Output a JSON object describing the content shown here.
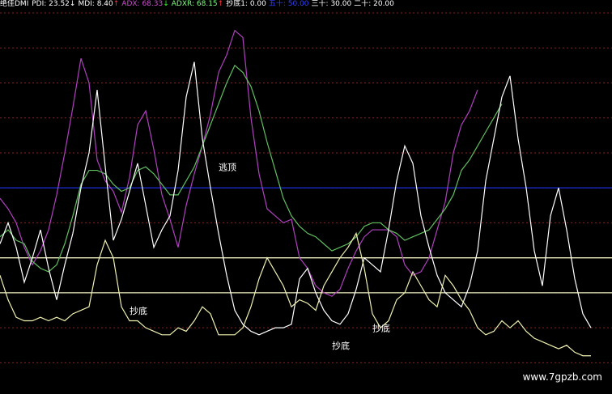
{
  "header": {
    "indicator_name": "绝佳DMI",
    "items": [
      {
        "text": "PDI: 23.52",
        "arrow": "↓",
        "color": "#ffffff",
        "arrow_color": "#ffffff"
      },
      {
        "text": "MDI: 8.40",
        "arrow": "↑",
        "color": "#ffffff",
        "arrow_color": "#ff3030"
      },
      {
        "text": "ADX: 68.33",
        "arrow": "↓",
        "color": "#d050d0",
        "arrow_color": "#30ff30"
      },
      {
        "text": "ADXR: 68.15",
        "arrow": "↑",
        "color": "#80ff80",
        "arrow_color": "#ff3030"
      },
      {
        "text": "抄底1: 0.00",
        "arrow": "",
        "color": "#ffffff",
        "arrow_color": "#ffffff"
      },
      {
        "text": "五十: 50.00",
        "arrow": "",
        "color": "#3040ff",
        "arrow_color": "#ffffff"
      },
      {
        "text": "三十: 30.00",
        "arrow": "",
        "color": "#ffffff",
        "arrow_color": "#ffffff"
      },
      {
        "text": "二十: 20.00",
        "arrow": "",
        "color": "#ffffff",
        "arrow_color": "#ffffff"
      }
    ]
  },
  "watermark": "www.7gpzb.com",
  "colors": {
    "background": "#000000",
    "pdi": "#ffffff",
    "mdi": "#f0f0b0",
    "adx": "#b040c0",
    "adxr": "#60c060",
    "fifty": "#1828c8",
    "thirty": "#f0f0c0",
    "twenty": "#f0f0c0",
    "grid": "#8a2020"
  },
  "chart_data": {
    "type": "line",
    "ylim": [
      -5,
      100
    ],
    "grid": true,
    "x": [
      0,
      1,
      2,
      3,
      4,
      5,
      6,
      7,
      8,
      9,
      10,
      11,
      12,
      13,
      14,
      15,
      16,
      17,
      18,
      19,
      20,
      21,
      22,
      23,
      24,
      25,
      26,
      27,
      28,
      29,
      30,
      31,
      32,
      33,
      34,
      35,
      36,
      37,
      38,
      39,
      40,
      41,
      42,
      43,
      44,
      45,
      46,
      47,
      48,
      49,
      50,
      51,
      52,
      53,
      54,
      55,
      56,
      57,
      58,
      59,
      60,
      61,
      62,
      63,
      64,
      65,
      66,
      67,
      68,
      69,
      70,
      71,
      72,
      73
    ],
    "series": [
      {
        "name": "ADX",
        "values": [
          47,
          44,
          40,
          33,
          28,
          32,
          38,
          48,
          60,
          73,
          87,
          80,
          58,
          52,
          49,
          43,
          53,
          68,
          72,
          61,
          48,
          41,
          33,
          45,
          54,
          62,
          71,
          83,
          88,
          95,
          93,
          70,
          54,
          44,
          42,
          40,
          41,
          30,
          27,
          22,
          20,
          19,
          21,
          27,
          32,
          36,
          38,
          38,
          38,
          36,
          28,
          25,
          26,
          30,
          38,
          46,
          60,
          68,
          72,
          78
        ]
      },
      {
        "name": "ADXR",
        "values": [
          36,
          38,
          35,
          34,
          29,
          27,
          26,
          28,
          34,
          42,
          51,
          55,
          55,
          54,
          51,
          49,
          50,
          55,
          56,
          54,
          51,
          48,
          48,
          52,
          56,
          62,
          68,
          74,
          80,
          85,
          83,
          79,
          72,
          63,
          55,
          47,
          42,
          39,
          37,
          36,
          34,
          32,
          33,
          34,
          36,
          39,
          40,
          40,
          38,
          37,
          35,
          36,
          37,
          38,
          41,
          44,
          48,
          55,
          58,
          62,
          66,
          70,
          74
        ]
      },
      {
        "name": "PDI",
        "values": [
          34,
          40,
          33,
          23,
          30,
          38,
          27,
          18,
          28,
          37,
          50,
          60,
          78,
          56,
          35,
          41,
          49,
          57,
          45,
          33,
          38,
          42,
          55,
          76,
          86,
          64,
          50,
          37,
          25,
          15,
          11,
          9,
          8,
          9,
          10,
          10,
          11,
          24,
          27,
          20,
          15,
          12,
          11,
          14,
          21,
          30,
          28,
          26,
          38,
          52,
          62,
          57,
          42,
          33,
          25,
          20,
          18,
          16,
          22,
          32,
          52,
          64,
          76,
          82,
          64,
          50,
          32,
          22,
          42,
          50,
          38,
          24,
          14,
          10
        ]
      },
      {
        "name": "MDI",
        "values": [
          25,
          18,
          13,
          12,
          12,
          13,
          12,
          13,
          12,
          14,
          15,
          16,
          28,
          35,
          30,
          16,
          12,
          12,
          10,
          9,
          8,
          8,
          10,
          9,
          12,
          16,
          14,
          8,
          8,
          8,
          10,
          16,
          24,
          30,
          26,
          22,
          16,
          18,
          17,
          15,
          22,
          26,
          30,
          33,
          37,
          27,
          14,
          10,
          12,
          18,
          20,
          26,
          22,
          18,
          16,
          25,
          22,
          18,
          15,
          10,
          8,
          9,
          12,
          10,
          12,
          9,
          7,
          6,
          5,
          4,
          5,
          3,
          2,
          2
        ]
      }
    ],
    "reference_lines": [
      {
        "name": "五十",
        "value": 50
      },
      {
        "name": "三十",
        "value": 30
      },
      {
        "name": "二十",
        "value": 20
      }
    ],
    "annotations": [
      {
        "text": "逃顶",
        "x": 27,
        "y": 55
      },
      {
        "text": "抄底",
        "x": 16,
        "y": 14
      },
      {
        "text": "抄底",
        "x": 41,
        "y": 4
      },
      {
        "text": "抄底",
        "x": 46,
        "y": 9
      }
    ]
  }
}
